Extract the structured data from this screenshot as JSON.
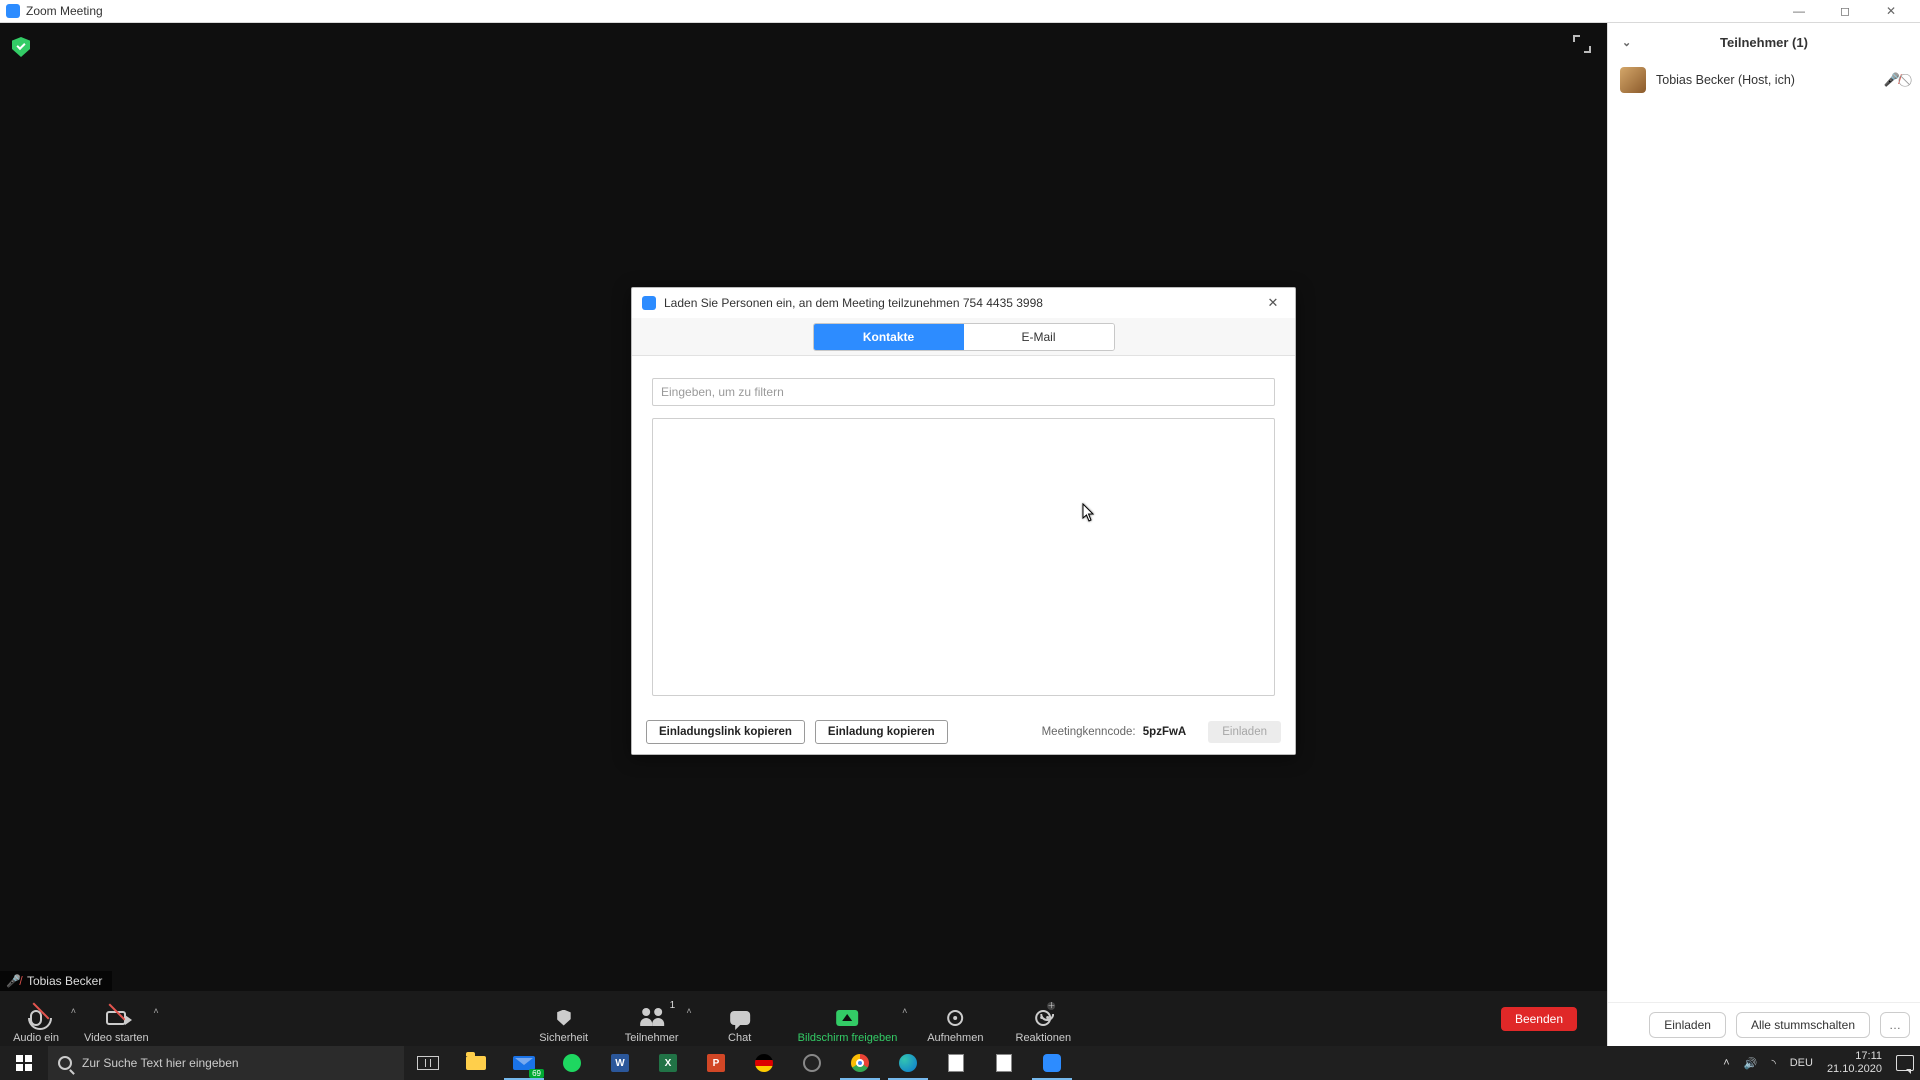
{
  "window": {
    "title": "Zoom Meeting"
  },
  "stage": {
    "self_name": "Tobias Becker"
  },
  "toolbar": {
    "audio": "Audio ein",
    "video": "Video starten",
    "security": "Sicherheit",
    "participants": "Teilnehmer",
    "participants_count": "1",
    "chat": "Chat",
    "share": "Bildschirm freigeben",
    "record": "Aufnehmen",
    "reactions": "Reaktionen",
    "leave": "Beenden"
  },
  "panel": {
    "title": "Teilnehmer (1)",
    "participants": [
      {
        "name": "Tobias Becker (Host, ich)"
      }
    ],
    "invite": "Einladen",
    "mute_all": "Alle stummschalten"
  },
  "dialog": {
    "title": "Laden Sie Personen ein, an dem Meeting teilzunehmen 754 4435 3998",
    "tab_contacts": "Kontakte",
    "tab_email": "E-Mail",
    "filter_placeholder": "Eingeben, um zu filtern",
    "copy_link": "Einladungslink kopieren",
    "copy_invite": "Einladung kopieren",
    "code_label": "Meetingkenncode:",
    "code_value": "5pzFwA",
    "invite_btn": "Einladen"
  },
  "taskbar": {
    "search_placeholder": "Zur Suche Text hier eingeben",
    "mail_badge": "69",
    "lang": "DEU",
    "time": "17:11",
    "date": "21.10.2020"
  }
}
